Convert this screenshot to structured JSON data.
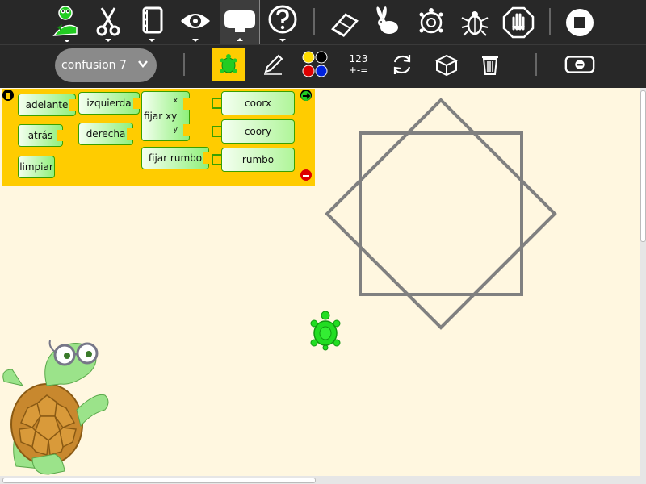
{
  "toolbar": {
    "items": [
      {
        "name": "activity-icon"
      },
      {
        "name": "scissors-icon"
      },
      {
        "name": "notebook-icon"
      },
      {
        "name": "eye-icon"
      },
      {
        "name": "palette-icon"
      },
      {
        "name": "help-icon"
      },
      {
        "name": "eraser-icon"
      },
      {
        "name": "rabbit-icon"
      },
      {
        "name": "turtle-icon"
      },
      {
        "name": "bug-icon"
      },
      {
        "name": "stop-hand-icon"
      },
      {
        "name": "stop-icon"
      }
    ]
  },
  "palette_toolbar": {
    "selector_value": "confusion 7",
    "numbers_label": "123",
    "operators_label": "+-="
  },
  "blocks": {
    "adelante": "adelante",
    "izquierda": "izquierda",
    "fijar_xy": "fijar xy",
    "x": "x",
    "y": "y",
    "atras": "atrás",
    "derecha": "derecha",
    "limpiar": "limpiar",
    "fijar_rumbo": "fijar rumbo",
    "coorx": "coorx",
    "coory": "coory",
    "rumbo": "rumbo"
  },
  "colors": {
    "toolbar": "#282828",
    "canvas": "#fff7e0",
    "palette": "#ffcc00",
    "block_green": "#8ff07a",
    "drawing": "#808080"
  }
}
